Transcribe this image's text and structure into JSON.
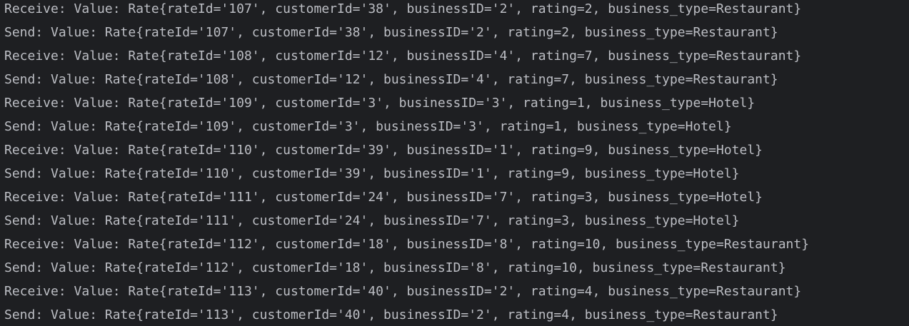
{
  "console": {
    "lines": [
      "Receive: Value: Rate{rateId='107', customerId='38', businessID='2', rating=2, business_type=Restaurant}",
      "Send: Value: Rate{rateId='107', customerId='38', businessID='2', rating=2, business_type=Restaurant}",
      "Receive: Value: Rate{rateId='108', customerId='12', businessID='4', rating=7, business_type=Restaurant}",
      "Send: Value: Rate{rateId='108', customerId='12', businessID='4', rating=7, business_type=Restaurant}",
      "Receive: Value: Rate{rateId='109', customerId='3', businessID='3', rating=1, business_type=Hotel}",
      "Send: Value: Rate{rateId='109', customerId='3', businessID='3', rating=1, business_type=Hotel}",
      "Receive: Value: Rate{rateId='110', customerId='39', businessID='1', rating=9, business_type=Hotel}",
      "Send: Value: Rate{rateId='110', customerId='39', businessID='1', rating=9, business_type=Hotel}",
      "Receive: Value: Rate{rateId='111', customerId='24', businessID='7', rating=3, business_type=Hotel}",
      "Send: Value: Rate{rateId='111', customerId='24', businessID='7', rating=3, business_type=Hotel}",
      "Receive: Value: Rate{rateId='112', customerId='18', businessID='8', rating=10, business_type=Restaurant}",
      "Send: Value: Rate{rateId='112', customerId='18', businessID='8', rating=10, business_type=Restaurant}",
      "Receive: Value: Rate{rateId='113', customerId='40', businessID='2', rating=4, business_type=Restaurant}",
      "Send: Value: Rate{rateId='113', customerId='40', businessID='2', rating=4, business_type=Restaurant}"
    ]
  },
  "colors": {
    "background": "#1e1f22",
    "text": "#bcbec4"
  }
}
